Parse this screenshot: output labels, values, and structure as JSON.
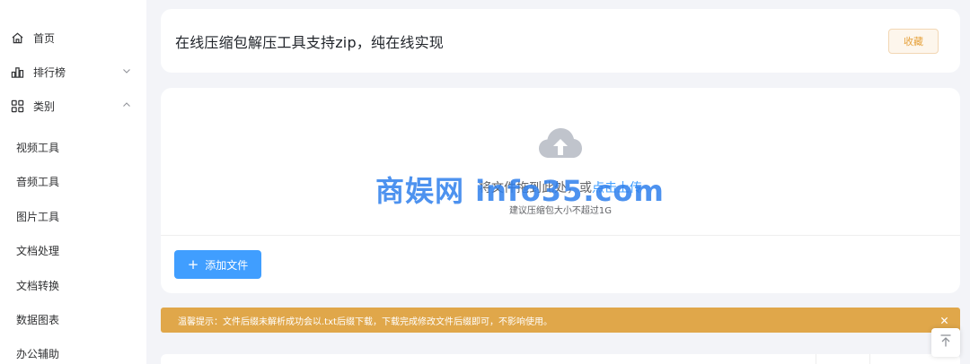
{
  "sidebar": {
    "items": [
      {
        "label": "首页",
        "icon": "home-icon"
      },
      {
        "label": "排行榜",
        "icon": "bar-chart-icon",
        "chevron": "chevron-down-icon"
      },
      {
        "label": "类别",
        "icon": "grid-icon",
        "chevron": "chevron-up-icon"
      }
    ],
    "sub_items": [
      "视频工具",
      "音频工具",
      "图片工具",
      "文档处理",
      "文档转换",
      "数据图表",
      "办公辅助"
    ]
  },
  "header": {
    "title": "在线压缩包解压工具支持zip，纯在线实现",
    "favorite_label": "收藏"
  },
  "upload": {
    "drop_text": "将文件拖到此处，或",
    "drop_link": "点击上传",
    "hint": "建议压缩包大小不超过1G",
    "add_button_label": "添加文件",
    "icon": "cloud-upload-icon"
  },
  "alert": {
    "text": "温馨提示：文件后缀未解析成功会以.txt后缀下载，下载完成修改文件后缀即可，不影响使用。"
  },
  "watermark": "商娱网 info35.com",
  "colors": {
    "primary": "#409eff",
    "warning_bg": "#e0a74a",
    "favorite_text": "#e6a23c",
    "page_bg": "#f3f4f8"
  }
}
